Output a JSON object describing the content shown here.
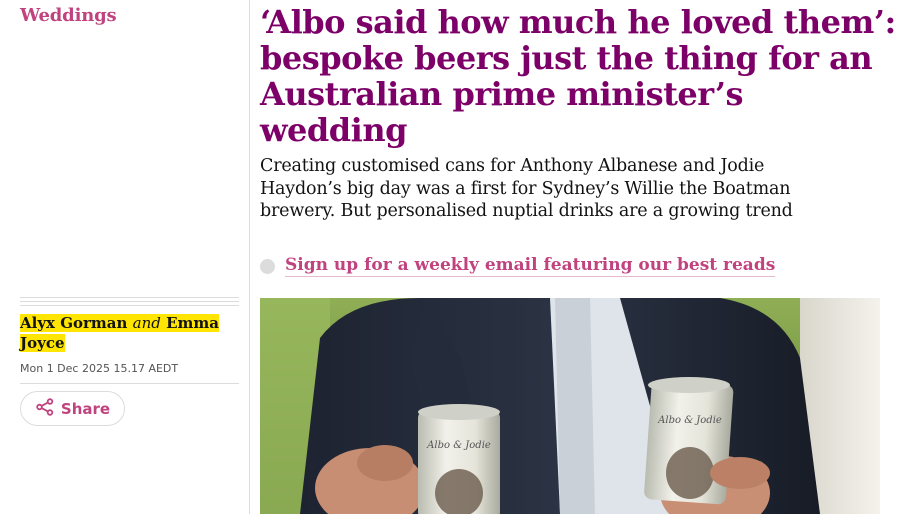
{
  "section": {
    "label": "Weddings"
  },
  "byline": {
    "author1": "Alyx Gorman",
    "conjunction": "and",
    "author2": "Emma Joyce"
  },
  "dateline": "Mon 1 Dec 2025 15.17 AEDT",
  "share": {
    "label": "Share",
    "icon": "share-icon"
  },
  "headline": "‘Albo said how much he loved them’: bespoke beers just the thing for an Australian prime minister’s wedding",
  "standfirst": "Creating customised cans for Anthony Albanese and Jodie Haydon’s big day was a first for Sydney’s Willie the Boatman brewery. But personalised nuptial drinks are a growing trend",
  "signup": {
    "label": "Sign up for a weekly email featuring our best reads"
  },
  "photo": {
    "can_left_text": "Albo & Jodie",
    "can_right_text": "Albo & Jodie"
  },
  "colors": {
    "section": "#c0437f",
    "headline": "#7d0068",
    "highlight": "#ffe500"
  }
}
